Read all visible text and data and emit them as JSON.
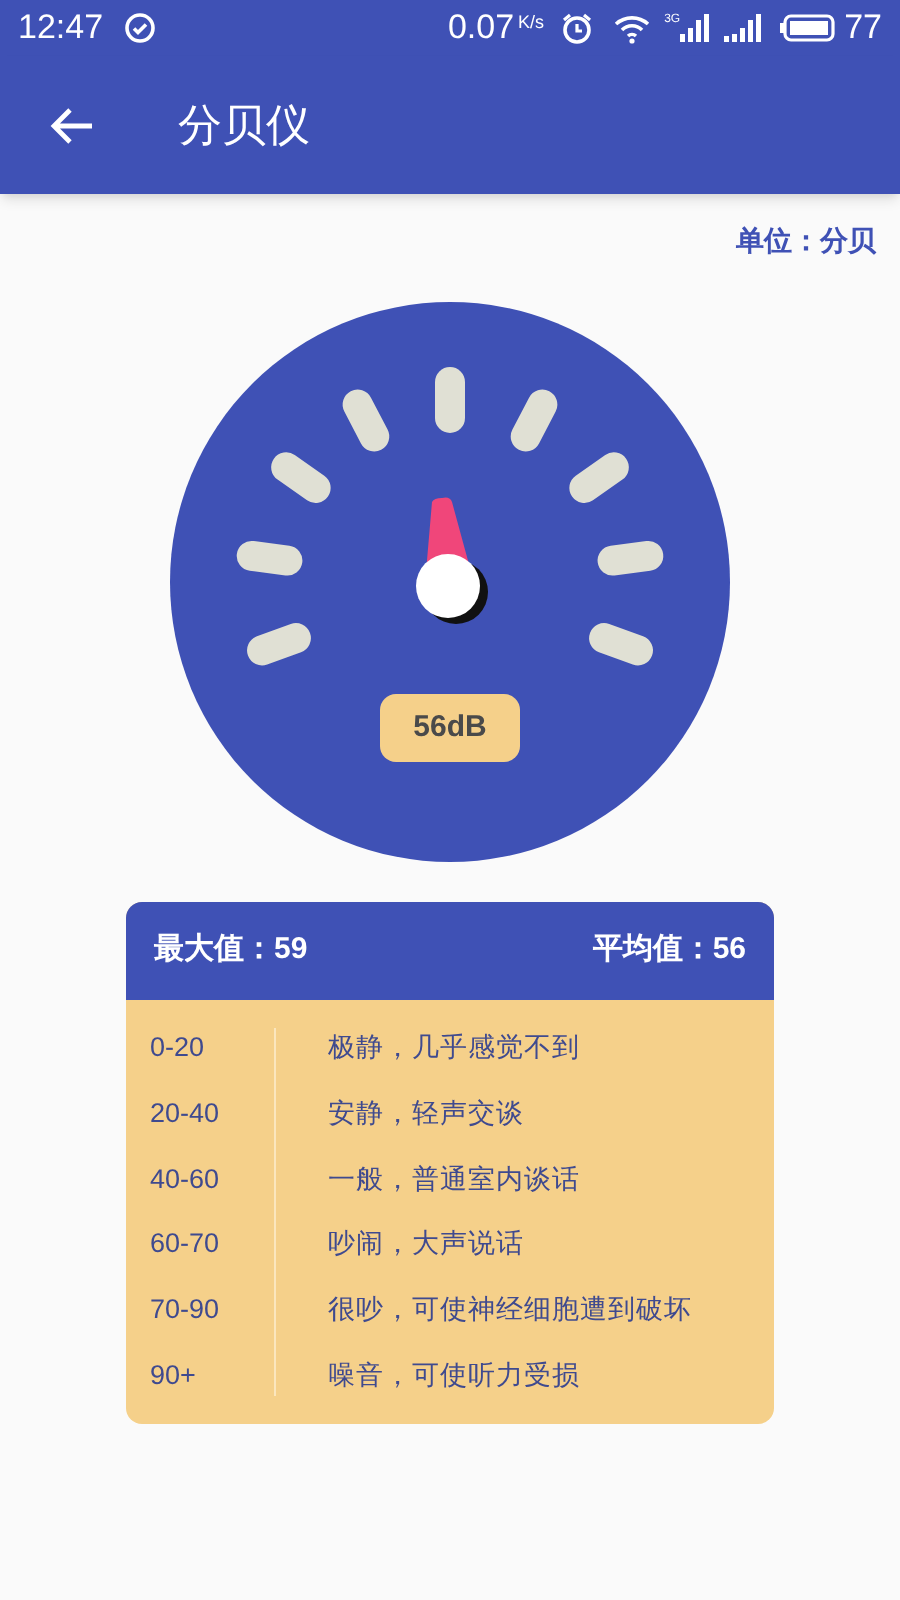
{
  "status_bar": {
    "time": "12:47",
    "net_speed": "0.07",
    "net_unit": "K/s",
    "network_type": "3G",
    "battery": "77"
  },
  "app_bar": {
    "title": "分贝仪"
  },
  "unit_label": "单位：分贝",
  "gauge": {
    "reading": "56dB"
  },
  "summary": {
    "max": "最大值：59",
    "average": "平均值：56"
  },
  "levels": [
    {
      "range": "0-20",
      "description": "极静，几乎感觉不到"
    },
    {
      "range": "20-40",
      "description": "安静，轻声交谈"
    },
    {
      "range": "40-60",
      "description": "一般，普通室内谈话"
    },
    {
      "range": "60-70",
      "description": "吵闹，大声说话"
    },
    {
      "range": "70-90",
      "description": "很吵，可使神经细胞遭到破坏"
    },
    {
      "range": "90+",
      "description": "噪音，可使听力受损"
    }
  ]
}
